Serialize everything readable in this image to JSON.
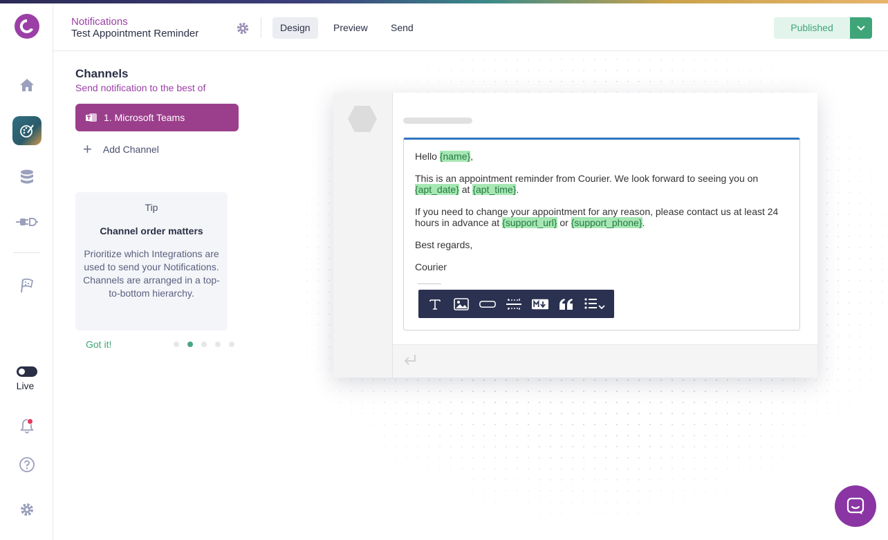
{
  "colors": {
    "brand": "#9b3fa7",
    "accent_green": "#3ea579",
    "toolbar": "#2b3150",
    "variable_bg": "#a7e7b3"
  },
  "rail": {
    "icons": [
      "home-icon",
      "design-icon",
      "database-icon",
      "integrations-icon",
      "flag-icon",
      "bell-icon",
      "help-icon",
      "gear-icon"
    ],
    "live_label": "Live"
  },
  "header": {
    "breadcrumb": "Notifications",
    "title": "Test Appointment Reminder",
    "tabs": [
      {
        "label": "Design",
        "active": true
      },
      {
        "label": "Preview",
        "active": false
      },
      {
        "label": "Send",
        "active": false
      }
    ],
    "status_label": "Published"
  },
  "channels": {
    "title": "Channels",
    "subtitle": "Send notification to the best of",
    "items": [
      {
        "label": "1.  Microsoft Teams"
      }
    ],
    "add_label": "Add Channel"
  },
  "tip": {
    "label": "Tip",
    "heading": "Channel order matters",
    "body": "Prioritize which Integrations are used to send your Notifications. Channels are arranged in a top-to-bottom hierarchy.",
    "dismiss": "Got it!",
    "pages": 5,
    "current_page": 2
  },
  "editor": {
    "greeting_prefix": "Hello ",
    "var_name": "{name}",
    "greeting_suffix": ",",
    "p2_text": "This is an appointment reminder from Courier. We look forward to seeing you on",
    "var_apt_date": "{apt_date}",
    "p2_at": " at ",
    "var_apt_time": "{apt_time}",
    "p2_end": ".",
    "p3_text": "If you need to change your appointment for any reason, please contact us at least 24 hours in advance at ",
    "var_support_url": "{support_url}",
    "p3_or": " or ",
    "var_support_phone": "{support_phone}",
    "p3_end": ".",
    "closing": "Best regards,",
    "signature": "Courier",
    "toolbar_icons": [
      "text-icon",
      "image-icon",
      "button-icon",
      "divider-icon",
      "markdown-icon",
      "quote-icon",
      "list-icon"
    ]
  }
}
